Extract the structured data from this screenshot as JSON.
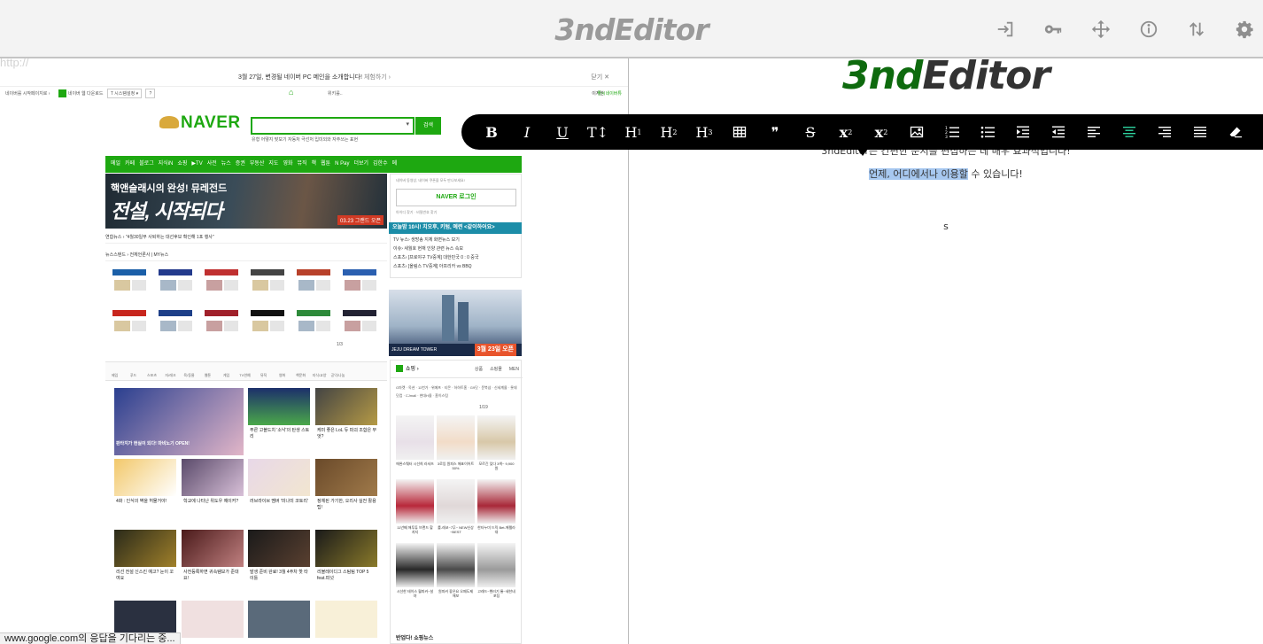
{
  "app": {
    "title": "3ndEditor"
  },
  "topbar_icons": [
    "import-icon",
    "key-icon",
    "move-icon",
    "info-icon",
    "sort-icon",
    "settings-icon"
  ],
  "left_pane": {
    "url": "http://",
    "status": "www.google.com의 응답을 기다리는 중...",
    "naver": {
      "notice": "3월 27일, 변경될 네이버 PC 메인을 소개합니다!",
      "notice_highlight": "네이버 PC 메인",
      "notice_link": "체험하기 ›",
      "notice_close": "닫기 ✕",
      "util_left": "네이버를 시작페이지로 ›",
      "util_mid": "네이버 웹 다운로드",
      "util_tools": "T 시스템설정 ▾",
      "util_help": "?",
      "util_search": "위키를..",
      "util_right1": "이지한",
      "util_right2": "좋시네이버튜",
      "logo": "NAVER",
      "search_btn": "검색",
      "suggestions": "유형 어떻지 맞보기   자동처 극선처   입미외와 자주쓰는 표현",
      "menu": [
        "메일",
        "카페",
        "블로그",
        "지식iN",
        "쇼핑",
        "▶TV",
        "사전",
        "뉴스",
        "증권",
        "부동산",
        "지도",
        "영화",
        "뮤직",
        "책",
        "웹툰",
        "N Pay",
        "더보기",
        "김한수",
        "메"
      ],
      "banner_line1": "핵앤슬래시의 완성! 뮤레전드",
      "banner_line2": "전설, 시작되다",
      "banner_date": "03.23 그랜드 오픈",
      "ticker": "연합뉴스 ›  \"4월30일부 사퇴하는 대선후보 확인해 1포 행사\"",
      "newsbar": "뉴스스탠드 ›   전체언론사  |  MY뉴스",
      "login_hint": "네이버 동영상, 네이버 쿠폰을 모두 만나보세요!",
      "login_btn": "NAVER 로그인",
      "login_small": "아이디 찾기  ·  비밀번호 찾기",
      "tv_bar": "오늘밤 10시!  치오후, 키텀, 예련 <같이하어요>",
      "tv_list": [
        "TV 뉴스› 생방송 지체 화면뉴스 보기",
        "이슈› 새월호 현재 인양 관련 뉴스 속보",
        "스포츠› [프로야구 TV중계] 대한민국 0 : 0 중국",
        "스포츠› [올림스 TV중계] 아프리카 vs BBQ"
      ],
      "tower_label": "JEJU DREAM TOWER",
      "tower_date": "3월 23일 오픈",
      "press_page": "1/3",
      "cats": [
        "제임",
        "푸드",
        "스포츠",
        "자/레크",
        "육/동물",
        "웹툰",
        "게임",
        "TV연예",
        "뮤직",
        "영화",
        "책문화",
        "지식/교양",
        "공익/나눔"
      ],
      "tiles": [
        {
          "cap": "판타지가 현실이 되다! 마비노기 OPEN!"
        },
        {
          "cap": "푸른 고블드치 '소낙'의 탄생 스토리"
        },
        {
          "cap": "케미 좋은 LoL 듀 파괴 조합은 무엇?"
        },
        {
          "cap": "4화 : 인식의 벽을 허물거야!"
        },
        {
          "cap": "학교에 나타난 위도우 예이커?"
        },
        {
          "cap": "러브라이브 멤버 '미나미 코토리'"
        },
        {
          "cap": "정체된 가기한, 오리사 실전 활용 팁!"
        },
        {
          "cap": "리선 전설 신스킨 예고? 눈이 꼬여요"
        },
        {
          "cap": "사전등록하면 귀속템보가 준대요!"
        },
        {
          "cap": "발생 준비 완료! 3월 4주차 핫 타이틀"
        },
        {
          "cap": "리볼레이디그 스팀팀 TOP 5 feat.피넛"
        }
      ],
      "shop_title": "쇼핑 ›",
      "shop_tabs": [
        "상품",
        "쇼핑몰",
        "MEN"
      ],
      "shop_links": "G마켓 · 옥션 · 11번가 · 위메프 · 티몬 · 하하트홈 · G9닷 · 문북샵 · 신세계몰 · 롯데닷컴 · CJmall · 현대H몰 · 홈이스텀",
      "shop_page": "1/19",
      "products": [
        "애완스웨터 시선희 라셔츠",
        "3로잉 원피스 애표이어트50%",
        "모르긴 잊다 3색~ 9,900원",
        "11년째 애투튜 브랜드 할지지",
        "롤-레코~7무~ NEW신상~BEST",
        "한타누미 드릭 Bet-에펠라대",
        "시선한 테이스 월피커~설야",
        "원피커 좋은요 오페도제 애보",
        "고래드~핸러기 롱~세한네포팅"
      ],
      "shop_news": "반업다! 쇼핑뉴스"
    }
  },
  "right_pane": {
    "brand_part1": "3nd",
    "brand_part2": "Editor",
    "line1": "3ndEditor는 간편한 문서를 편집하는 데 매우 효과적입니다!",
    "line2_selected": "언제, 어디에서나 이용할",
    "line2_rest": " 수 있습니다!",
    "line3": "s"
  },
  "toolbar": {
    "buttons": [
      {
        "name": "bold-button",
        "label": "B"
      },
      {
        "name": "italic-button",
        "label": "I"
      },
      {
        "name": "underline-button",
        "label": "U"
      },
      {
        "name": "font-size-button",
        "label": "T↕"
      },
      {
        "name": "heading1-button",
        "label": "H",
        "sup": "1"
      },
      {
        "name": "heading2-button",
        "label": "H",
        "sup": "2"
      },
      {
        "name": "heading3-button",
        "label": "H",
        "sup": "3"
      },
      {
        "name": "table-button",
        "icon": "table-icon"
      },
      {
        "name": "blockquote-button",
        "label": "❞"
      },
      {
        "name": "strikethrough-button",
        "label": "S"
      },
      {
        "name": "subscript-button",
        "label": "x",
        "sub": "2"
      },
      {
        "name": "superscript-button",
        "label": "x",
        "sup": "2"
      },
      {
        "name": "image-button",
        "icon": "image-icon"
      },
      {
        "name": "ordered-list-button",
        "icon": "ordered-list-icon"
      },
      {
        "name": "unordered-list-button",
        "icon": "unordered-list-icon"
      },
      {
        "name": "indent-button",
        "icon": "indent-icon"
      },
      {
        "name": "outdent-button",
        "icon": "outdent-icon"
      },
      {
        "name": "align-left-button",
        "icon": "align-left-icon"
      },
      {
        "name": "align-center-button",
        "icon": "align-center-icon"
      },
      {
        "name": "align-right-button",
        "icon": "align-right-icon"
      },
      {
        "name": "align-justify-button",
        "icon": "align-justify-icon"
      },
      {
        "name": "eraser-button",
        "icon": "eraser-icon"
      }
    ]
  },
  "colors": {
    "accent": "#1ea811",
    "brand_green": "#0e6a0e",
    "toolbar_bg": "#000000",
    "selection": "#a7c8f0"
  }
}
